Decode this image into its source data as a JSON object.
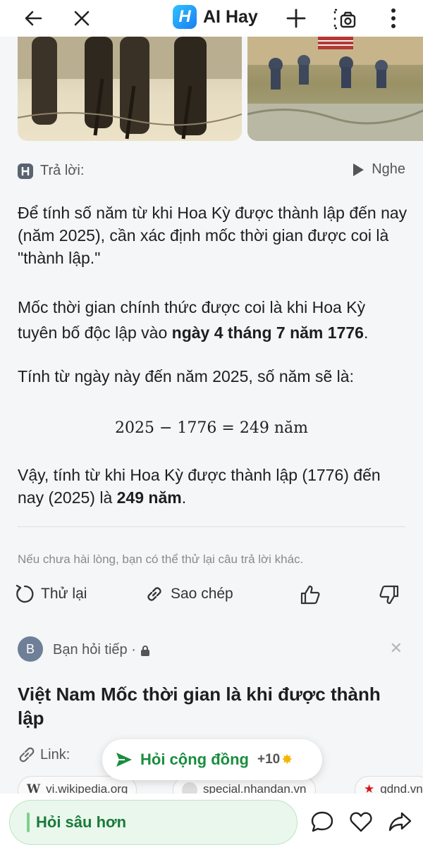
{
  "app": {
    "name": "AI Hay",
    "logo_letter": "H"
  },
  "topbar": {
    "icons": [
      "back-arrow-icon",
      "close-icon",
      "plus-icon",
      "camera-scan-icon",
      "more-vertical-icon"
    ]
  },
  "answer": {
    "label": "Trả lời:",
    "listen_label": "Nghe",
    "p1": "Để tính số năm từ khi Hoa Kỳ được thành lập đến nay (năm 2025), cần xác định mốc thời gian được coi là \"thành lập.\"",
    "p2_prefix": "Mốc thời gian chính thức được coi là khi Hoa Kỳ tuyên bố độc lập vào ",
    "p2_bold": "ngày 4 tháng 7 năm 1776",
    "p2_suffix": ".",
    "p3": "Tính từ ngày này đến năm 2025, số năm sẽ là:",
    "formula": "2025 − 1776 = 249 năm",
    "p4_prefix": "Vậy, tính từ khi Hoa Kỳ được thành lập (1776) đến nay (2025) là ",
    "p4_bold": "249 năm",
    "p4_suffix": ".",
    "hint": "Nếu chưa hài lòng, bạn có thể thử lại câu trả lời khác."
  },
  "actions": {
    "retry_label": "Thử lại",
    "copy_label": "Sao chép"
  },
  "followup": {
    "avatar_letter": "B",
    "label": "Bạn hỏi tiếp ·",
    "question": "Việt Nam Mốc thời gian là khi được thành lập",
    "link_label": "Link:"
  },
  "community": {
    "label": "Hỏi cộng đồng",
    "points": "+10"
  },
  "sources": [
    {
      "label": "vi.wikipedia.org"
    },
    {
      "label": "special.nhandan.vn"
    },
    {
      "label": "qdnd.vn"
    }
  ],
  "bottom": {
    "ask_label": "Hỏi sâu hơn"
  },
  "colors": {
    "accent_green": "#1a8d3f",
    "brand_blue": "#1b7cf2"
  }
}
